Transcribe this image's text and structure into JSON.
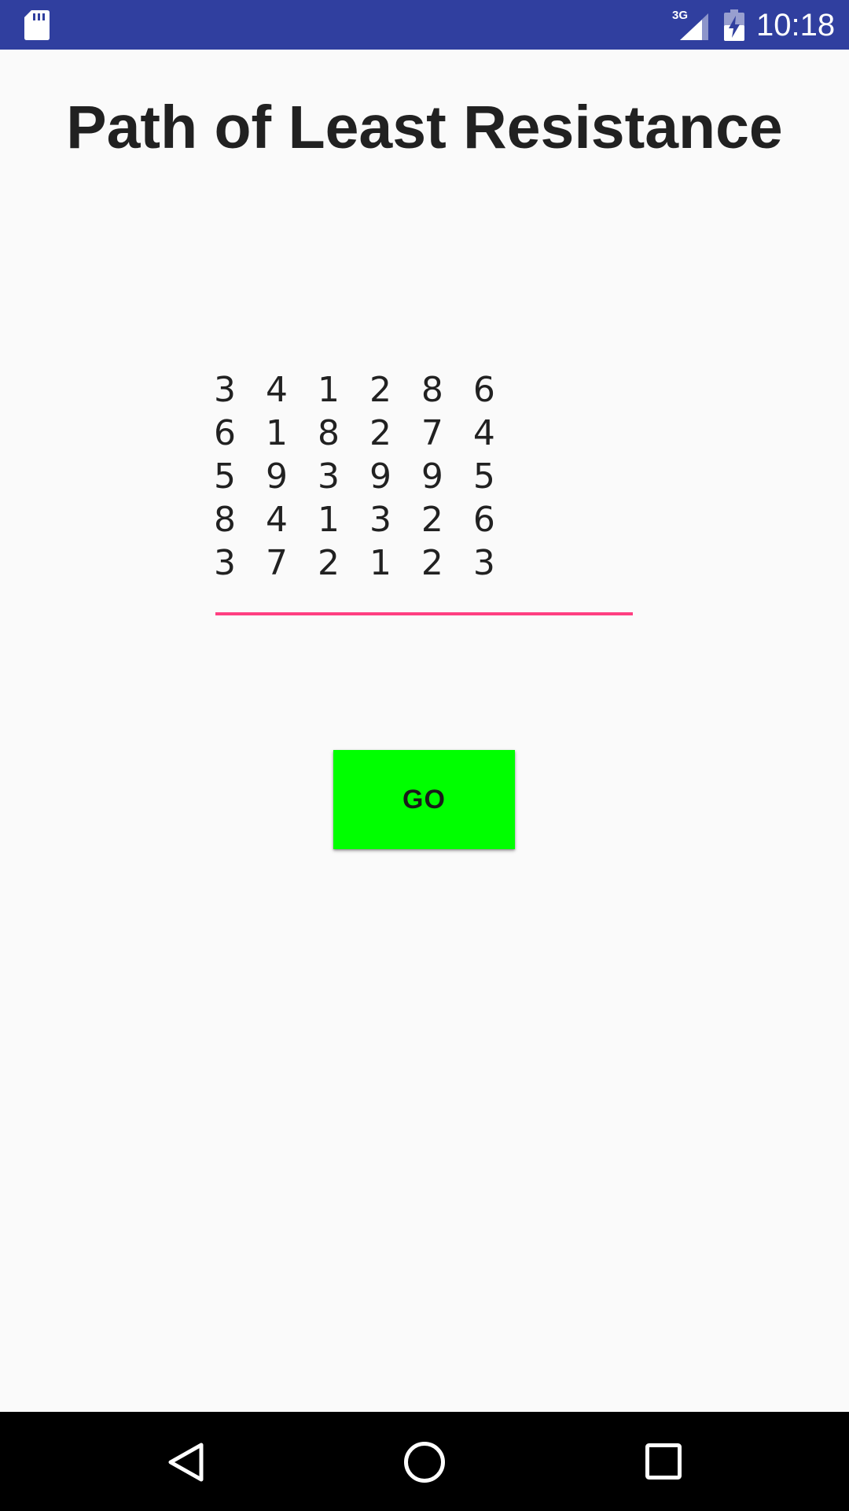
{
  "status_bar": {
    "time": "10:18",
    "network_label": "3G",
    "icons": [
      "sd-card-icon",
      "cellular-signal-icon",
      "battery-charging-icon"
    ],
    "background": "#303f9f"
  },
  "main": {
    "title": "Path of Least Resistance",
    "grid_value": "3 4 1 2 8 6\n6 1 8 2 7 4\n5 9 3 9 9 5\n8 4 1 3 2 6\n3 7 2 1 2 3",
    "accent_color": "#ff4081",
    "go_button": {
      "label": "GO",
      "color": "#00ff00"
    }
  },
  "nav_bar": {
    "icons": [
      "back-icon",
      "home-icon",
      "recents-icon"
    ]
  }
}
